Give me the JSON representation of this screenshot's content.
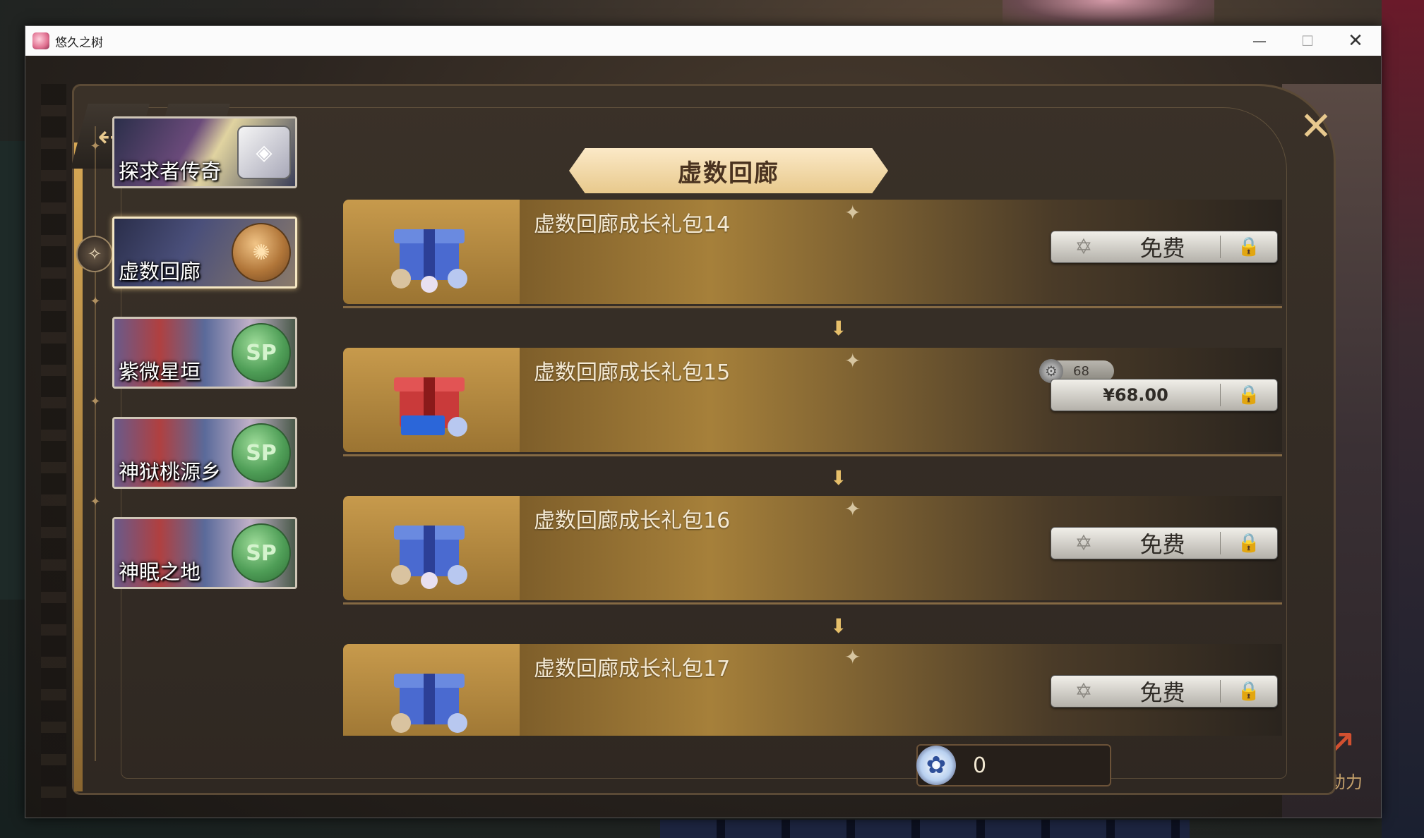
{
  "window": {
    "title": "悠久之树",
    "controls": {
      "minimize": "—",
      "maximize": "☐",
      "close": "✕"
    }
  },
  "nav": {
    "back_icon": "back-arrow-icon",
    "home_icon": "home-icon",
    "close_icon": "close-x-icon"
  },
  "header": {
    "title": "虚数回廊"
  },
  "sidebar": {
    "items": [
      {
        "label": "探求者传奇",
        "coin": "",
        "active": false
      },
      {
        "label": "虚数回廊",
        "coin": "",
        "active": true
      },
      {
        "label": "紫微星垣",
        "coin": "SP",
        "active": false
      },
      {
        "label": "神狱桃源乡",
        "coin": "SP",
        "active": false
      },
      {
        "label": "神眠之地",
        "coin": "SP",
        "active": false
      }
    ]
  },
  "packs": [
    {
      "name": "虚数回廊成长礼包14",
      "button": "免费",
      "tag": ""
    },
    {
      "name": "虚数回廊成长礼包15",
      "button": "¥68.00",
      "tag": "68"
    },
    {
      "name": "虚数回廊成长礼包16",
      "button": "免费",
      "tag": ""
    },
    {
      "name": "虚数回廊成长礼包17",
      "button": "免费",
      "tag": ""
    }
  ],
  "currency": {
    "value": "0",
    "icon": "star-flower-icon"
  },
  "side_widget": {
    "label": "成长助力"
  }
}
